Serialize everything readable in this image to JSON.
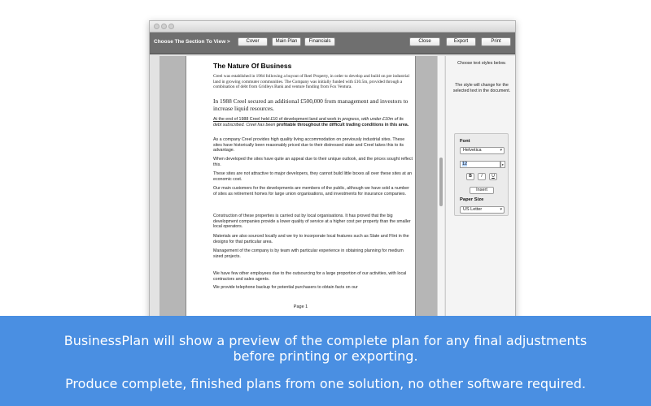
{
  "toolbar": {
    "section_label": "Choose The Section To View >",
    "buttons": {
      "cover": "Cover",
      "main_plan": "Main Plan",
      "financials": "Financials",
      "close": "Close",
      "export": "Export",
      "print": "Print"
    }
  },
  "document": {
    "title": "The Nature Of Business",
    "para1": "Creel was established in 1984 following a buyout of Reel Property, in order to develop and build on pre industrial land in growing commuter communities. The Company was initially funded with £10.5m, provided through a combination of debt from Gridleys Bank and venture funding from Fox Ventura.",
    "para2": "In 1988 Creel secured an additional £500,000 from management and investors to increase liquid resources.",
    "para3_underlined": "At the end of 1988 Creel held £10 of development land and work in",
    "para3_italic": " progress, with under £10m of its debt subscribed. Creel has been ",
    "para3_bold": "profitable throughout the difficult trading conditions in this area.",
    "para4": "As a company Creel provides high quality living accommodation on previously industrial sites. These sites have historically been reasonably priced due to their distressed state and Creel takes this to its advantage.",
    "para5": "When developed the sites have quite an appeal due to their unique outlook, and the prices sought reflect this.",
    "para6": "These sites are not attractive to major developers, they cannot build little boxes all over these sites at an economic cost.",
    "para7": "Our main customers for the developments are members of the public, although we have sold a number of sites as retirement homes for large union organisations, and investments for insurance companies.",
    "para8": "Construction of these properties is carried out by local organisations. It has proved that the big development companies provide a lower quality of service at a higher cost per property than the smaller local operators.",
    "para9": "Materials are also sourced locally and we try to incorporate local features such as Slate and Flint in the designs for that particular area.",
    "para10": "Management of the company is by team with particular experience in obtaining planning for medium sized projects.",
    "para11": "We have few other employees due to the outsourcing for a large proportion of our activities, with local contractors and sales agents.",
    "para12": "We provide telephone backup for potential purchasers to obtain facts on our",
    "page_number": "Page 1"
  },
  "sidebar": {
    "instruction1": "Choose text styles below.",
    "instruction2": "The style will change for the selected text in the document.",
    "font_label": "Font",
    "font_value": "Helvetica",
    "size_value": "12",
    "bold_label": "B",
    "italic_label": "I",
    "underline_label": "U",
    "insert_label": "Insert",
    "paper_size_label": "Paper Size",
    "paper_size_value": "US Letter"
  },
  "banner": {
    "line1": "BusinessPlan will show a preview of the complete plan for any final adjustments",
    "line2": "before printing or exporting.",
    "line3": "Produce complete, finished plans from one solution, no other software required."
  },
  "colors": {
    "banner": "#4a8fe2",
    "toolbar": "#6f6f6f",
    "preview_bg": "#b6b6b6"
  }
}
